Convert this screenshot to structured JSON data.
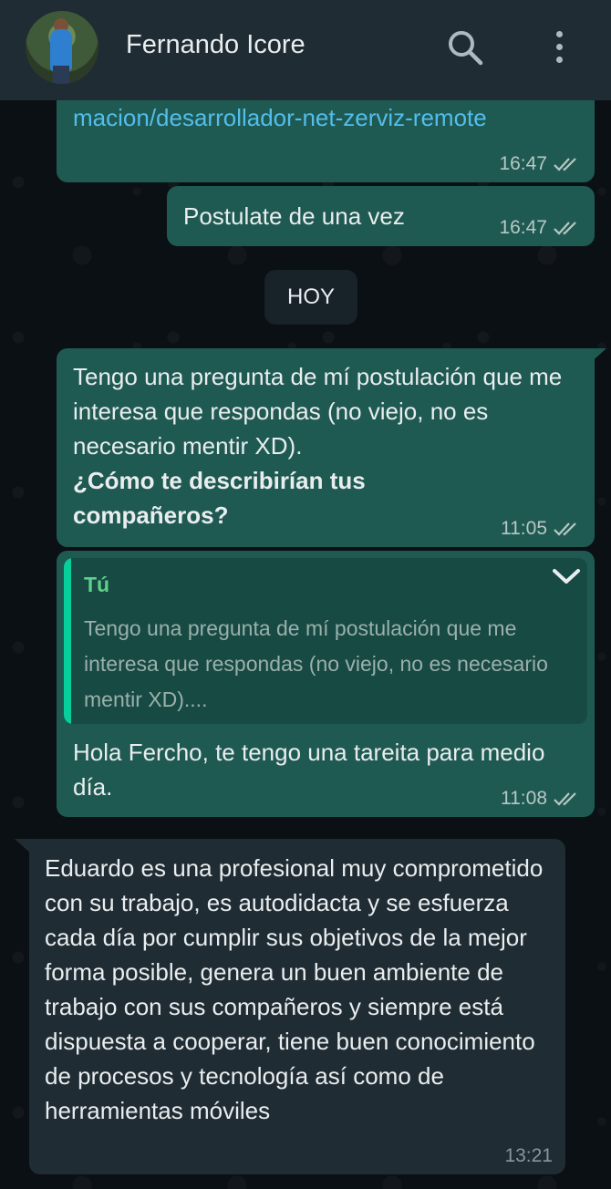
{
  "header": {
    "contact_name": "Fernando Icore",
    "icons": [
      "avatar",
      "search-icon",
      "more-options-icon"
    ]
  },
  "messages": [
    {
      "type": "outgoing",
      "text": "macion/desarrollador-net-zerviz-remote",
      "is_link": true,
      "time": "16:47",
      "status": "read"
    },
    {
      "type": "outgoing",
      "text": "Postulate de una vez",
      "time": "16:47",
      "status": "read"
    },
    {
      "type": "date_separator",
      "text": "HOY"
    },
    {
      "type": "outgoing",
      "text": "Tengo una pregunta de mí postulación que me interesa que respondas (no viejo, no es necesario mentir XD).",
      "bold_text": "¿Cómo te describirían tus compañeros?",
      "time": "11:05",
      "status": "read"
    },
    {
      "type": "outgoing_reply",
      "quote_author": "Tú",
      "quote_text": "Tengo una pregunta de mí postulación que me interesa que respondas (no viejo, no es necesario mentir XD)....",
      "text": "Hola Fercho, te tengo una tareita para medio día.",
      "time": "11:08",
      "status": "read"
    },
    {
      "type": "incoming",
      "text": "Eduardo es una profesional muy comprometido con su trabajo, es autodidacta y se esfuerza cada día por cumplir sus objetivos de la mejor forma posible, genera un buen ambiente de trabajo con sus compañeros y siempre está dispuesta a cooperar, tiene buen conocimiento de procesos y tecnología así como de herramientas móviles",
      "time": "13:21"
    }
  ],
  "colors": {
    "header_bg": "#202c33",
    "outgoing_bubble": "#1f5a52",
    "incoming_bubble": "#202c33",
    "link": "#53bdeb",
    "quote_accent": "#06cf9c"
  }
}
